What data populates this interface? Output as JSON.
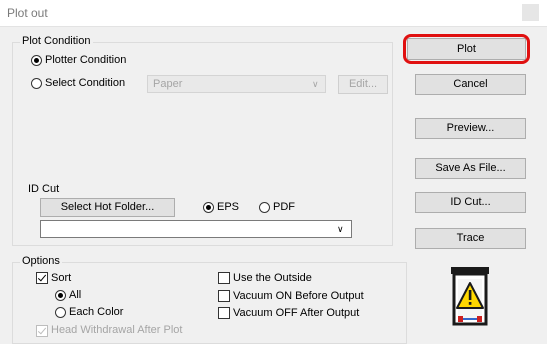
{
  "window": {
    "title": "Plot out"
  },
  "plot_condition": {
    "label": "Plot Condition",
    "plotter_condition_label": "Plotter Condition",
    "select_condition_label": "Select Condition",
    "condition_value": "Paper",
    "edit_label": "Edit..."
  },
  "id_cut": {
    "label": "ID Cut",
    "select_hot_folder_label": "Select Hot Folder...",
    "eps_label": "EPS",
    "pdf_label": "PDF",
    "path_value": ""
  },
  "options": {
    "label": "Options",
    "sort_label": "Sort",
    "all_label": "All",
    "each_color_label": "Each Color",
    "head_withdrawal_label": "Head Withdrawal After Plot",
    "use_outside_label": "Use the Outside",
    "vacuum_on_label": "Vacuum ON Before Output",
    "vacuum_off_label": "Vacuum OFF After Output"
  },
  "buttons": {
    "plot": "Plot",
    "cancel": "Cancel",
    "preview": "Preview...",
    "save_as_file": "Save As File...",
    "id_cut": "ID Cut...",
    "trace": "Trace"
  },
  "state": {
    "plotter_condition_selected": true,
    "select_condition_selected": false,
    "eps_selected": true,
    "pdf_selected": false,
    "sort_checked": true,
    "all_selected": true,
    "each_color_selected": false,
    "head_withdrawal_checked": true,
    "use_outside_checked": false,
    "vacuum_on_checked": false,
    "vacuum_off_checked": false
  },
  "icons": {
    "device": "plotter-warning-icon",
    "window": "window-control-icon"
  },
  "colors": {
    "highlight": "#e01010",
    "warning": "#ffd800"
  }
}
